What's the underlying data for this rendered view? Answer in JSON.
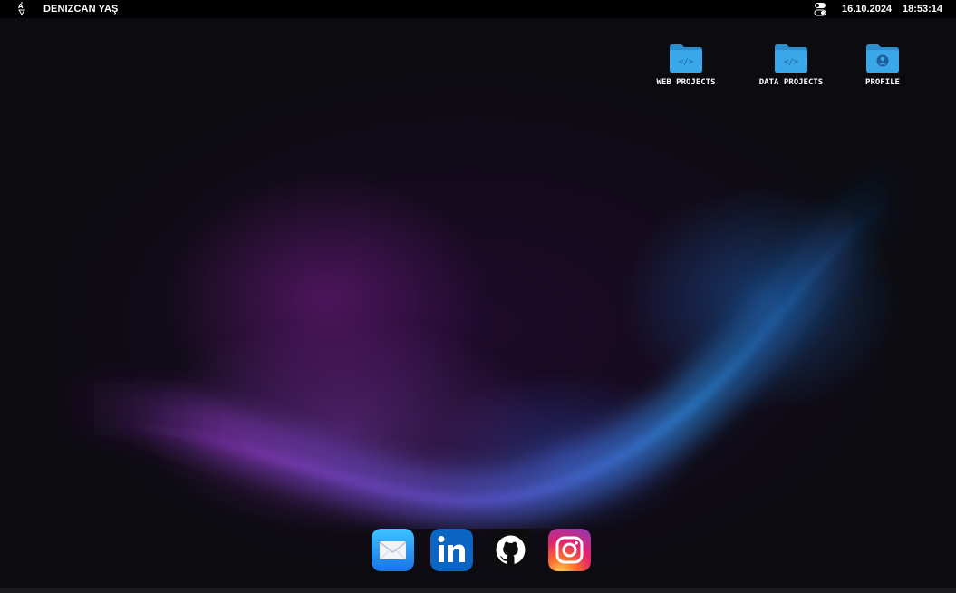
{
  "topbar": {
    "menu_icon": "sort-arrows-icon",
    "user_name": "DENIZCAN YAŞ",
    "toggle_icon": "toggle-switch-icon",
    "date": "16.10.2024",
    "time": "18:53:14"
  },
  "desktop_icons": [
    {
      "label": "WEB PROJECTS",
      "icon": "code-folder-icon"
    },
    {
      "label": "DATA PROJECTS",
      "icon": "code-folder-icon"
    },
    {
      "label": "PROFILE",
      "icon": "user-folder-icon"
    }
  ],
  "dock": [
    {
      "name": "Mail",
      "icon": "mail-icon"
    },
    {
      "name": "LinkedIn",
      "icon": "linkedin-icon"
    },
    {
      "name": "GitHub",
      "icon": "github-icon"
    },
    {
      "name": "Instagram",
      "icon": "instagram-icon"
    }
  ],
  "colors": {
    "folder": "#3aa7e8",
    "folder_tab": "#2b8fcf",
    "topbar": "#000000",
    "wallpaper_purple": "#7a2a9a",
    "wallpaper_blue": "#2a7fd8"
  }
}
